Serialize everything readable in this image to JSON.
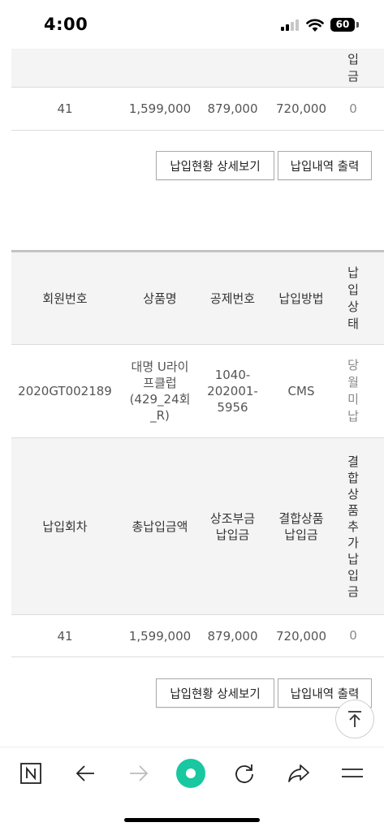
{
  "status": {
    "time": "4:00",
    "battery": "60"
  },
  "table_top_partial": {
    "header_col5_tail": "입\n금",
    "row": [
      "41",
      "1,599,000",
      "879,000",
      "720,000",
      "0"
    ]
  },
  "buttons": {
    "detail": "납입현황 상세보기",
    "print": "납입내역 출력"
  },
  "member_table": {
    "headers": [
      "회원번호",
      "상품명",
      "공제번호",
      "납입방법",
      "납\n입\n상\n태"
    ],
    "row": [
      "2020GT002189",
      "대명 U라이\n프클럽\n(429_24회\n_R)",
      "1040-\n202001-\n5956",
      "CMS",
      "당\n월\n미\n납"
    ]
  },
  "payment_table": {
    "headers": [
      "납입회차",
      "총납입금액",
      "상조부금\n납입금",
      "결합상품\n납입금",
      "결\n합\n상\n품\n추\n가\n납\n입\n금"
    ],
    "row": [
      "41",
      "1,599,000",
      "879,000",
      "720,000",
      "0"
    ]
  },
  "icons": {
    "scroll_top": "arrow-up-icon",
    "toolbar": [
      "naver-n-icon",
      "back-arrow-icon",
      "forward-arrow-icon",
      "green-dot-icon",
      "refresh-icon",
      "share-icon",
      "menu-icon"
    ]
  },
  "colors": {
    "header_bg": "#f4f4f4",
    "border": "#dcdcdc",
    "green": "#1ec800"
  }
}
